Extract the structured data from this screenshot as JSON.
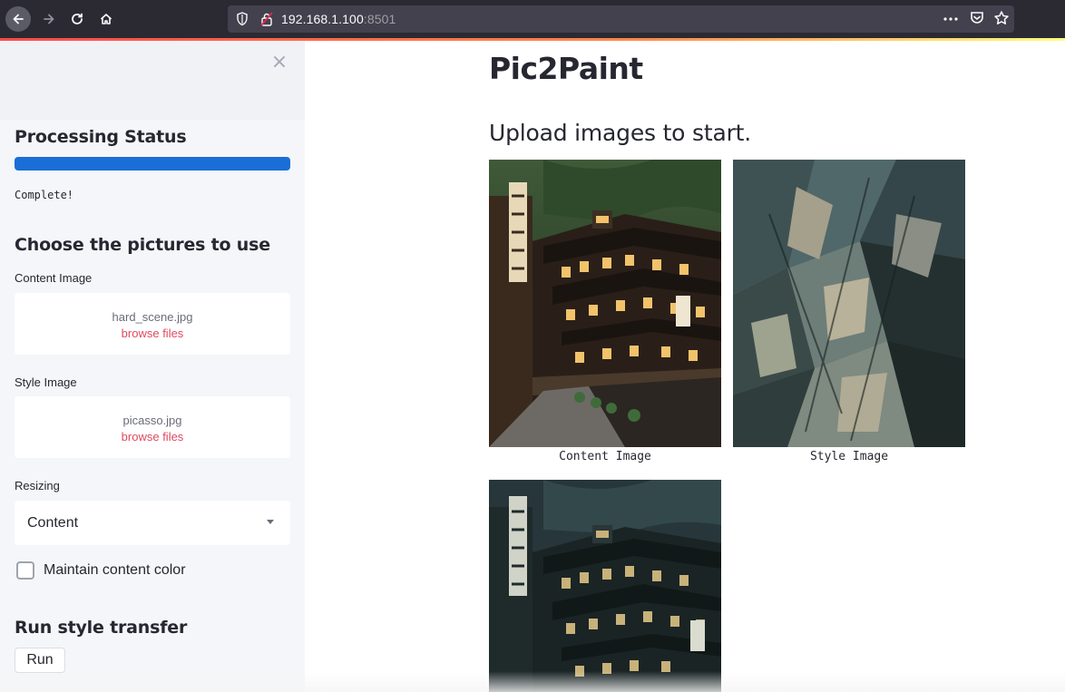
{
  "browser": {
    "url_host": "192.168.1.100",
    "url_port": ":8501"
  },
  "sidebar": {
    "processing_title": "Processing Status",
    "progress": 1.0,
    "status": "Complete!",
    "choose_title": "Choose the pictures to use",
    "content_label": "Content Image",
    "content_file": "hard_scene.jpg",
    "style_label": "Style Image",
    "style_file": "picasso.jpg",
    "browse_label": "browse files",
    "resizing_label": "Resizing",
    "resizing_value": "Content",
    "maintain_label": "Maintain content color",
    "maintain_checked": false,
    "run_title": "Run style transfer",
    "run_button": "Run"
  },
  "main": {
    "title": "Pic2Paint",
    "subtitle": "Upload images to start.",
    "captions": {
      "content": "Content Image",
      "style": "Style Image"
    }
  },
  "colors": {
    "progress": "#1a6ed6",
    "browse_link": "#e04a5f",
    "sidebar_bg": "#f0f2f6"
  }
}
